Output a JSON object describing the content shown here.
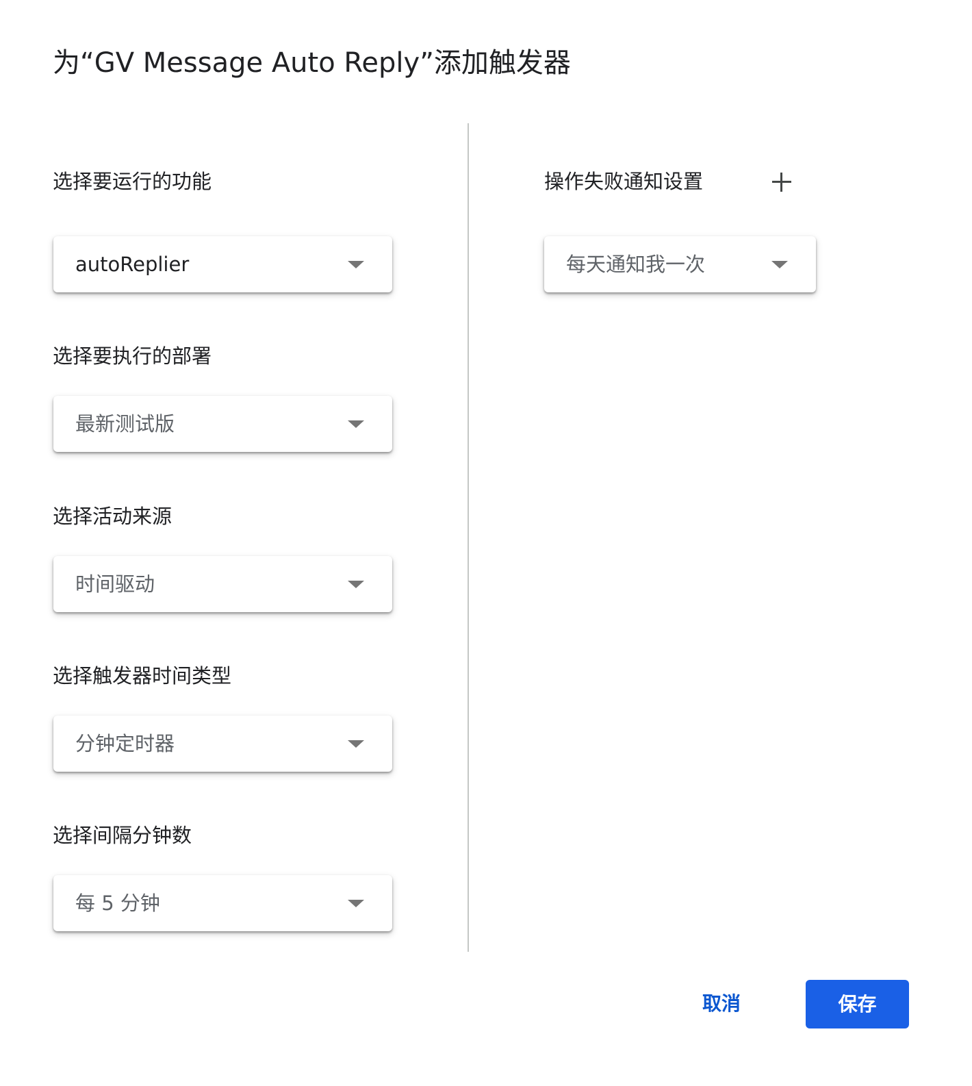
{
  "dialog": {
    "title": "为“GV Message Auto Reply”添加触发器"
  },
  "left": {
    "fields": [
      {
        "label": "选择要运行的功能",
        "value": "autoReplier"
      },
      {
        "label": "选择要执行的部署",
        "value": "最新测试版"
      },
      {
        "label": "选择活动来源",
        "value": "时间驱动"
      },
      {
        "label": "选择触发器时间类型",
        "value": "分钟定时器"
      },
      {
        "label": "选择间隔分钟数",
        "value": "每 5 分钟"
      }
    ]
  },
  "right": {
    "failure_label": "操作失败通知设置",
    "failure_value": "每天通知我一次",
    "add_icon": "plus-icon"
  },
  "actions": {
    "cancel_label": "取消",
    "save_label": "保存"
  },
  "colors": {
    "primary": "#1a60e6",
    "link": "#0b57d0",
    "text": "#202124",
    "muted": "#5f6368"
  }
}
